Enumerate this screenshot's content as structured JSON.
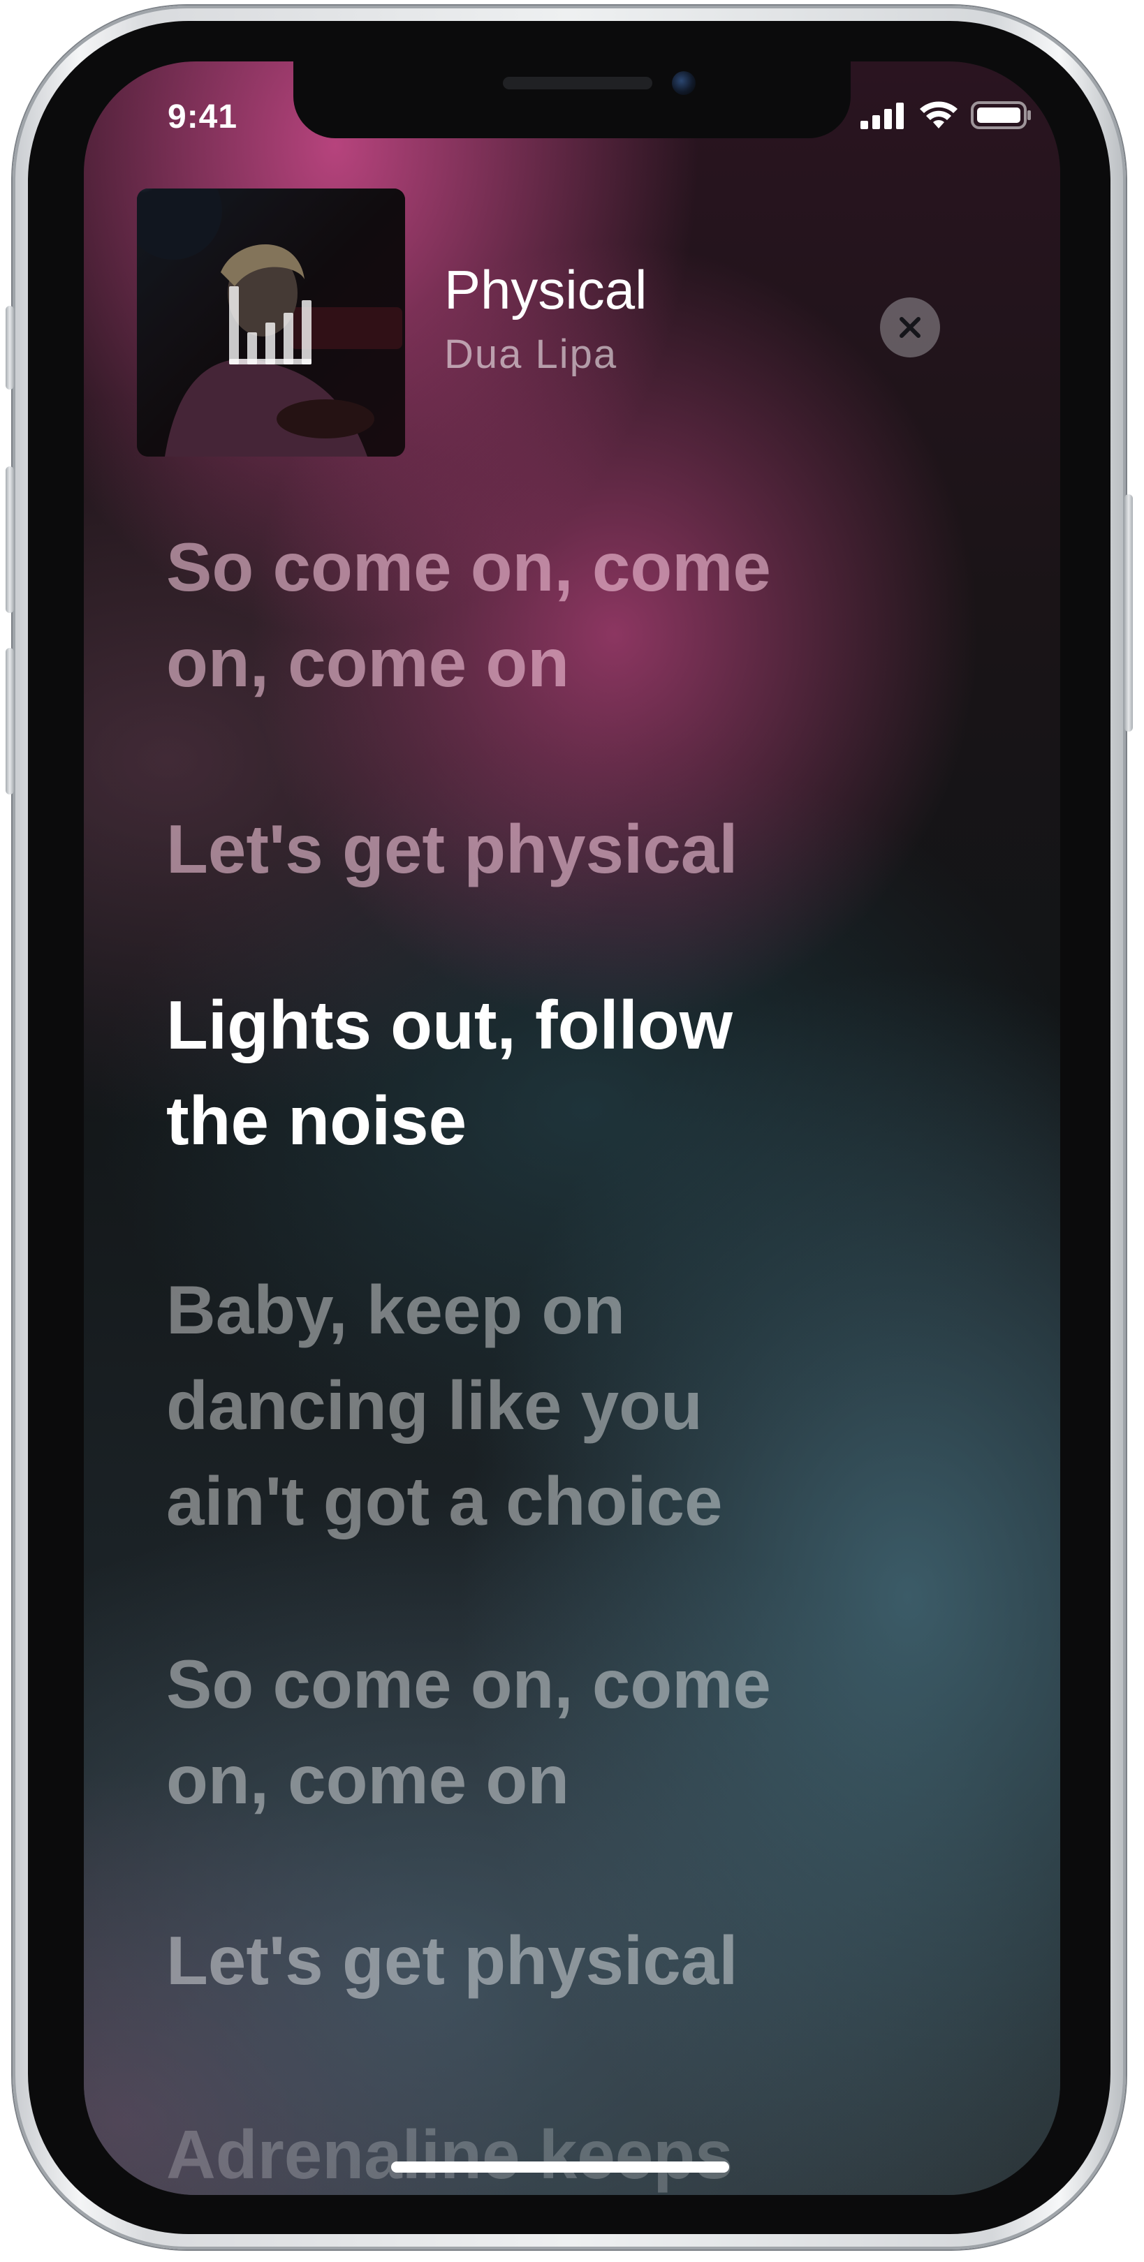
{
  "status_bar": {
    "time": "9:41",
    "icons": [
      "cellular-signal-icon",
      "wifi-icon",
      "battery-icon"
    ]
  },
  "now_playing": {
    "title": "Physical",
    "artist": "Dua Lipa",
    "artwork_icon": "equalizer-icon"
  },
  "controls": {
    "close_icon": "close-icon"
  },
  "lyrics": {
    "lines": [
      {
        "text": "So come on, come on, come on",
        "line1": "So come on, come",
        "line2": "on, come on",
        "state": "past"
      },
      {
        "text": "Let's get physical",
        "line1": "Let's get physical",
        "state": "past"
      },
      {
        "text": "Lights out, follow the noise",
        "line1": "Lights out, follow",
        "line2": "the noise",
        "state": "current"
      },
      {
        "text": "Baby, keep on dancing like you ain't got a choice",
        "line1": "Baby, keep on",
        "line2": "dancing like you",
        "line3": "ain't got a choice",
        "state": "upcoming"
      },
      {
        "text": "So come on, come on, come on",
        "line1": "So come on, come",
        "line2": "on, come on",
        "state": "upcoming"
      },
      {
        "text": "Let's get physical",
        "line1": "Let's get physical",
        "state": "upcoming"
      },
      {
        "text": "Adrenaline keeps",
        "line1": "Adrenaline keeps",
        "state": "upcoming"
      }
    ]
  },
  "colors": {
    "accent_pink": "#be4682",
    "current_lyric": "#ffffff",
    "dim_lyric": "rgba(255,255,255,0.42)"
  }
}
